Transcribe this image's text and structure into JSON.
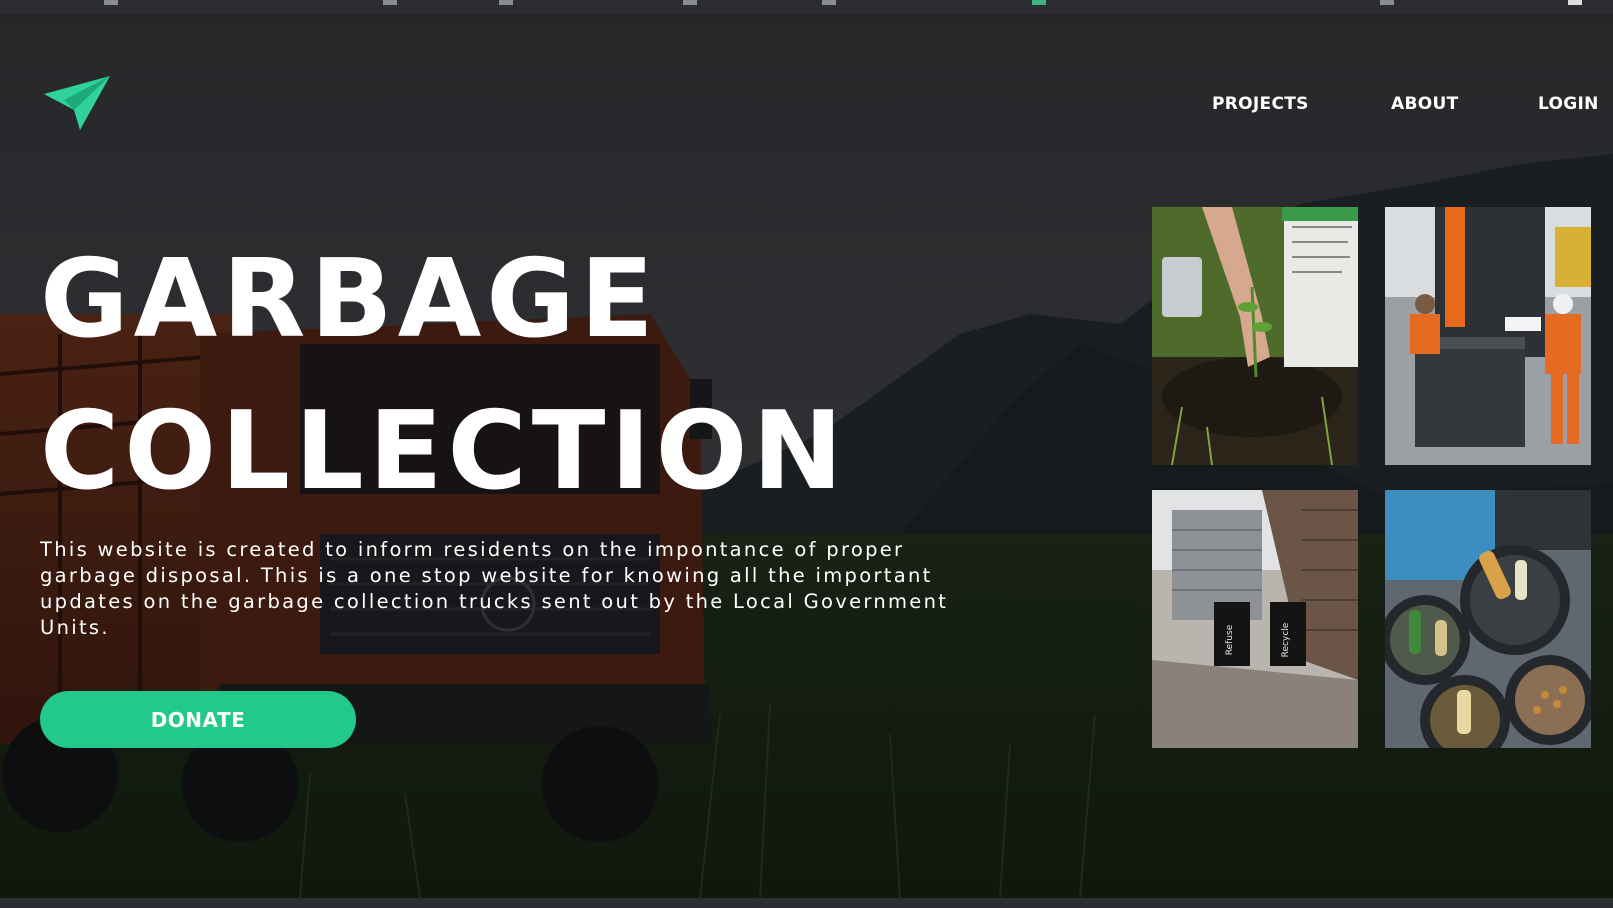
{
  "nav": {
    "projects": "PROJECTS",
    "about": "ABOUT",
    "login": "LOGIN"
  },
  "hero": {
    "title_line1": "GARBAGE",
    "title_line2": "COLLECTION",
    "description": "This website is created to inform residents on the impontance of proper garbage disposal. This is a one stop website for knowing all the important updates on the garbage collection trucks sent out by the Local Government Units.",
    "donate_label": "DONATE"
  },
  "gallery": {
    "bin_label_left": "Refuse",
    "bin_label_right": "Recycle"
  },
  "colors": {
    "accent": "#22c98a",
    "logo": "#2fd39a",
    "text": "#ffffff"
  },
  "icons": {
    "logo": "paper-plane-icon"
  }
}
